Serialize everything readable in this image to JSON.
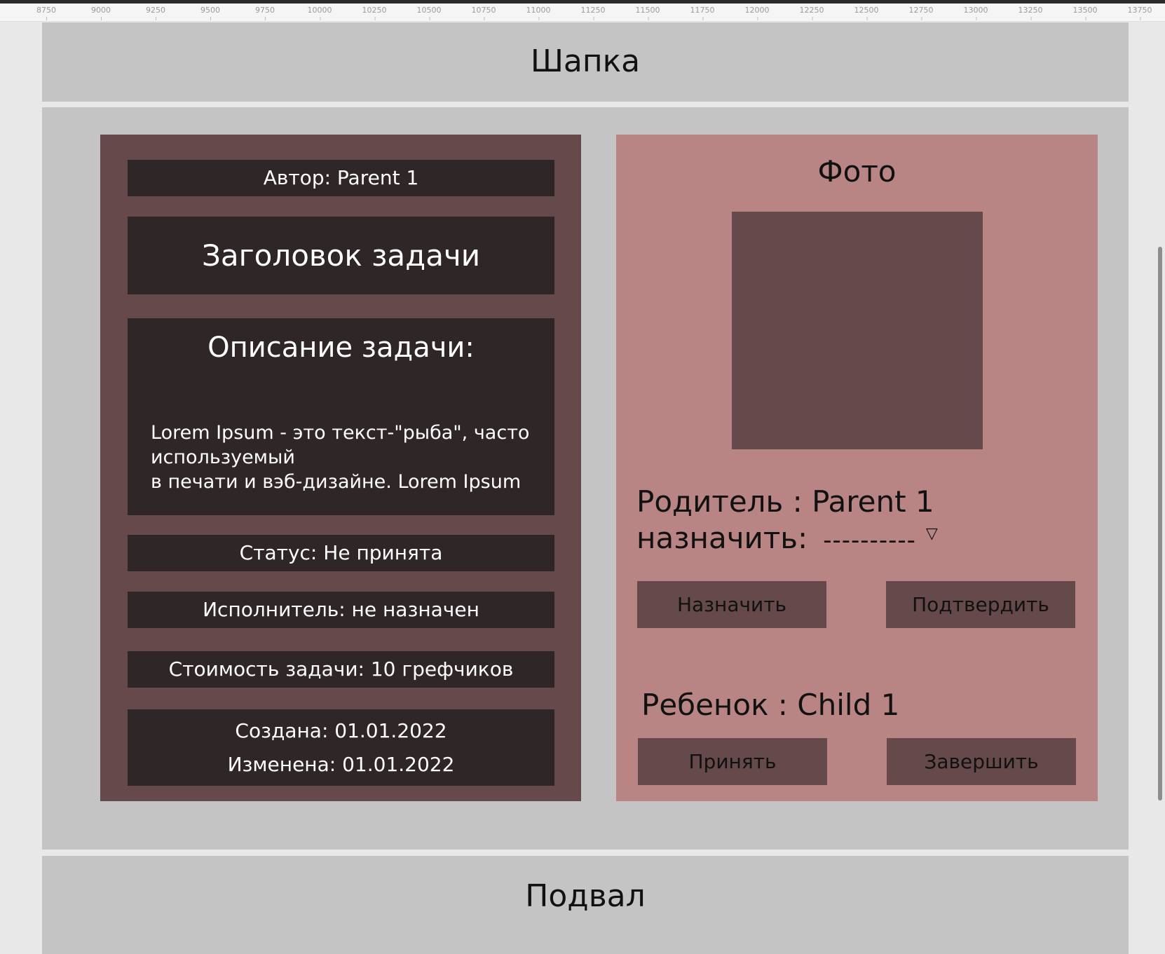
{
  "ruler": {
    "ticks": [
      "8750",
      "9000",
      "9250",
      "9500",
      "9750",
      "10000",
      "10250",
      "10500",
      "10750",
      "11000",
      "11250",
      "11500",
      "11750",
      "12000",
      "12250",
      "12500",
      "12750",
      "13000",
      "13250",
      "13500",
      "13750"
    ]
  },
  "header": {
    "title": "Шапка"
  },
  "footer": {
    "title": "Подвал"
  },
  "task": {
    "author": "Автор: Parent 1",
    "title": "Заголовок задачи",
    "description_title": "Описание задачи:",
    "description_body": "Lorem Ipsum - это текст-\"рыба\", часто используемый\n в печати и вэб-дизайне. Lorem Ipsum",
    "status": "Статус: Не принята",
    "executor": "Исполнитель: не назначен",
    "cost": "Стоимость задачи: 10 грефчиков",
    "created": "Создана: 01.01.2022",
    "modified": "Изменена: 01.01.2022"
  },
  "side": {
    "photo_label": "Фото",
    "parent": "Родитель : Parent 1",
    "assign_label": "назначить:",
    "assign_value": "----------",
    "assign_button": "Назначить",
    "confirm_button": "Подтвердить",
    "child": "Ребенок : Child 1",
    "accept_button": "Принять",
    "finish_button": "Завершить"
  },
  "colors": {
    "panel_dark": "#66494a",
    "box_dark": "#2f2627",
    "panel_pink": "#b98584",
    "frame_gray": "#c4c4c4"
  }
}
